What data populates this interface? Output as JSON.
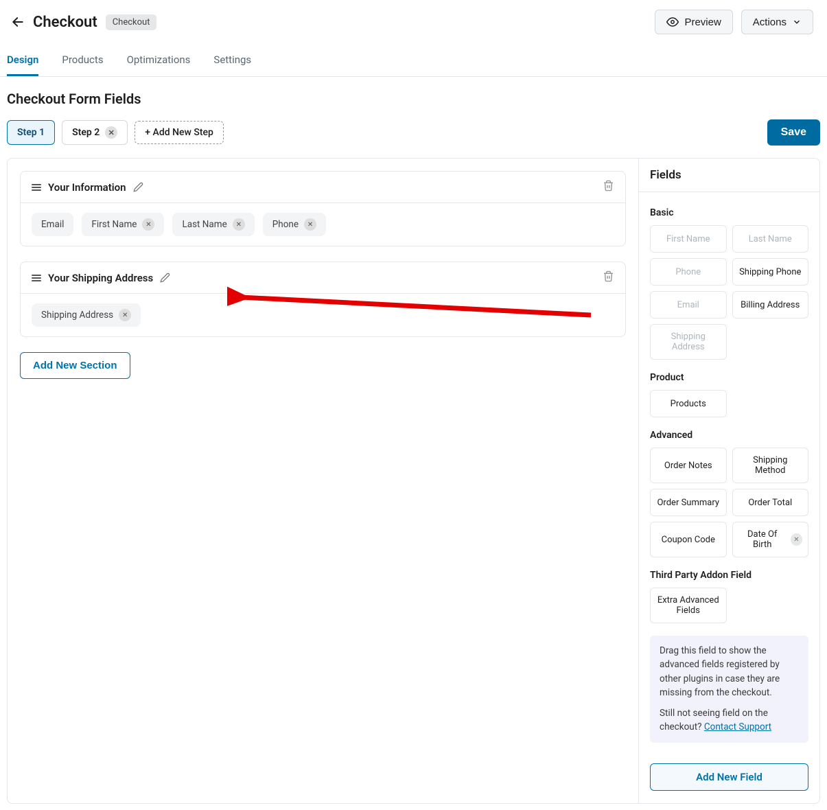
{
  "header": {
    "title": "Checkout",
    "badge": "Checkout",
    "preview": "Preview",
    "actions": "Actions"
  },
  "tabs": [
    "Design",
    "Products",
    "Optimizations",
    "Settings"
  ],
  "activeTab": 0,
  "sectionTitle": "Checkout Form Fields",
  "steps": {
    "items": [
      "Step 1",
      "Step 2"
    ],
    "addLabel": "+ Add New Step",
    "saveLabel": "Save"
  },
  "sections": [
    {
      "title": "Your Information",
      "fields": [
        {
          "label": "Email",
          "removable": false
        },
        {
          "label": "First Name",
          "removable": true
        },
        {
          "label": "Last Name",
          "removable": true
        },
        {
          "label": "Phone",
          "removable": true
        }
      ]
    },
    {
      "title": "Your Shipping Address",
      "fields": [
        {
          "label": "Shipping Address",
          "removable": true
        }
      ]
    }
  ],
  "addSection": "Add New Section",
  "sidebar": {
    "title": "Fields",
    "groups": [
      {
        "label": "Basic",
        "fields": [
          {
            "label": "First Name",
            "used": true
          },
          {
            "label": "Last Name",
            "used": true
          },
          {
            "label": "Phone",
            "used": true
          },
          {
            "label": "Shipping Phone",
            "used": false
          },
          {
            "label": "Email",
            "used": true
          },
          {
            "label": "Billing Address",
            "used": false
          },
          {
            "label": "Shipping Address",
            "used": true
          }
        ]
      },
      {
        "label": "Product",
        "fields": [
          {
            "label": "Products",
            "used": false
          }
        ]
      },
      {
        "label": "Advanced",
        "fields": [
          {
            "label": "Order Notes",
            "used": false
          },
          {
            "label": "Shipping Method",
            "used": false
          },
          {
            "label": "Order Summary",
            "used": false
          },
          {
            "label": "Order Total",
            "used": false
          },
          {
            "label": "Coupon Code",
            "used": false
          },
          {
            "label": "Date Of Birth",
            "used": false,
            "removable": true
          }
        ]
      },
      {
        "label": "Third Party Addon Field",
        "fields": [
          {
            "label": "Extra Advanced Fields",
            "used": false
          }
        ]
      }
    ],
    "infoText1": "Drag this field to show the advanced fields registered by other plugins in case they are missing from the checkout.",
    "infoText2": "Still not seeing field on the checkout?",
    "infoLink": "Contact Support",
    "addField": "Add New Field"
  }
}
